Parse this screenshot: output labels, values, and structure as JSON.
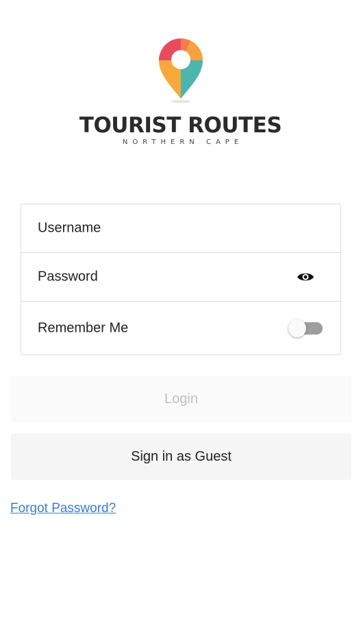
{
  "brand": {
    "title": "TOURIST ROUTES",
    "subtitle": "NORTHERN CAPE",
    "logo_icon": "map-pin-icon",
    "colors": {
      "pin_top_left": "#e84a5f",
      "pin_top_right": "#f4a340",
      "pin_bottom_left": "#f7a93b",
      "pin_bottom_right": "#4db6ac"
    }
  },
  "form": {
    "username_placeholder": "Username",
    "password_placeholder": "Password",
    "password_visibility_icon": "eye-icon",
    "remember_label": "Remember Me",
    "remember_on": false
  },
  "actions": {
    "login_label": "Login",
    "guest_label": "Sign in as Guest",
    "forgot_label": "Forgot Password?"
  },
  "colors": {
    "link": "#3a7bd5",
    "disabled_text": "#c0c0c0",
    "toggle_track": "#9e9e9e"
  }
}
